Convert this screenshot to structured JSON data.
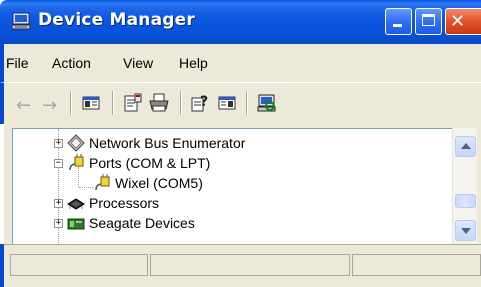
{
  "window": {
    "title": "Device Manager",
    "title_icon": "computer-monitor-icon",
    "colors": {
      "titlebar": "#0a56e0",
      "close_button": "#e2522a",
      "chrome": "#ece9d8"
    }
  },
  "menu": {
    "items": [
      {
        "label": "File"
      },
      {
        "label": "Action"
      },
      {
        "label": "View"
      },
      {
        "label": "Help"
      }
    ]
  },
  "toolbar": {
    "buttons": [
      {
        "icon": "back-arrow-icon"
      },
      {
        "icon": "forward-arrow-icon"
      },
      {
        "icon": "show-hide-console-tree-icon"
      },
      {
        "icon": "properties-icon"
      },
      {
        "icon": "print-icon"
      },
      {
        "icon": "help-icon"
      },
      {
        "icon": "show-hide-action-pane-icon"
      },
      {
        "icon": "scan-hardware-changes-icon"
      }
    ]
  },
  "tree": {
    "rows": [
      {
        "label": "Network Bus Enumerator",
        "icon": "network-bus-icon",
        "expander": "+"
      },
      {
        "label": "Ports (COM & LPT)",
        "icon": "port-connector-icon",
        "expander": "−"
      },
      {
        "label": "Wixel (COM5)",
        "icon": "port-connector-icon",
        "expander": ""
      },
      {
        "label": "Processors",
        "icon": "processor-chip-icon",
        "expander": "+"
      },
      {
        "label": "Seagate Devices",
        "icon": "storage-device-icon",
        "expander": "+"
      }
    ]
  }
}
